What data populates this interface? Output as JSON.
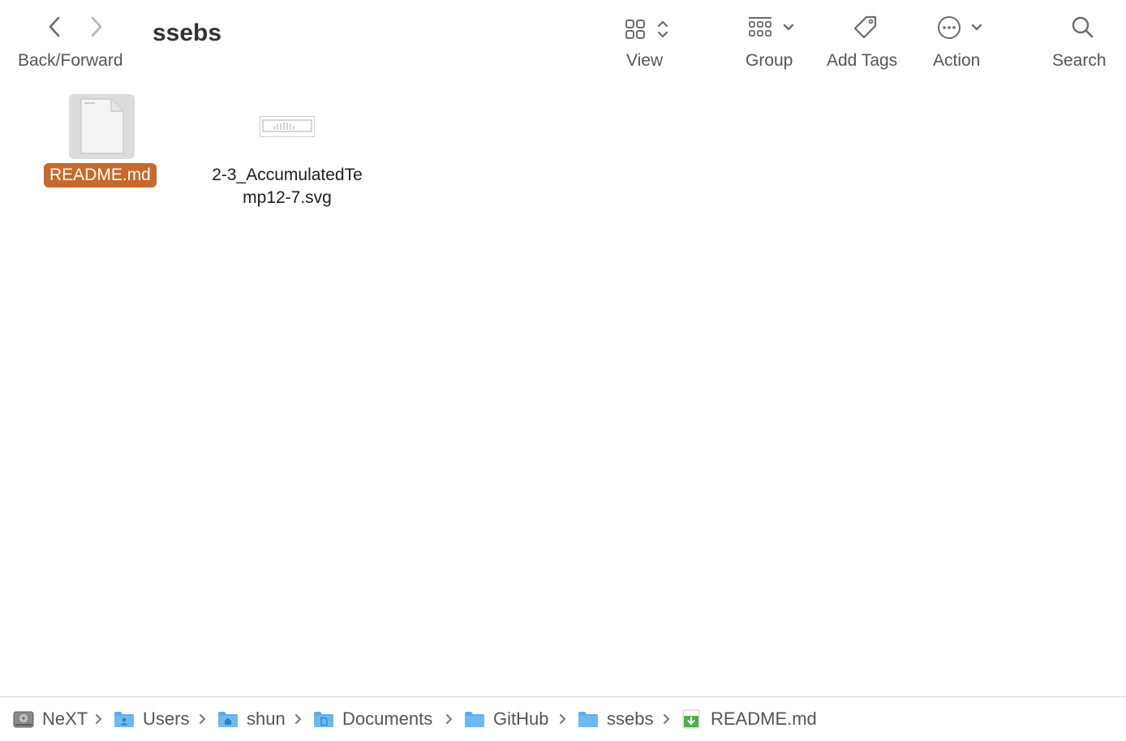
{
  "window": {
    "title": "ssebs"
  },
  "toolbar": {
    "back_forward": "Back/Forward",
    "view": "View",
    "group": "Group",
    "add_tags": "Add Tags",
    "action": "Action",
    "search": "Search"
  },
  "files": [
    {
      "name": "README.md",
      "icon": "document-icon",
      "selected": true
    },
    {
      "name_line1": "2-3_AccumulatedTe",
      "name_line2": "mp12-7.svg",
      "icon": "svg-thumbnail-icon",
      "selected": false
    }
  ],
  "pathbar": {
    "items": [
      {
        "label": "NeXT",
        "icon": "hard-drive-icon"
      },
      {
        "label": "Users",
        "icon": "users-folder-icon"
      },
      {
        "label": "shun",
        "icon": "home-folder-icon"
      },
      {
        "label": "Documents",
        "icon": "documents-folder-icon"
      },
      {
        "label": "GitHub",
        "icon": "folder-icon"
      },
      {
        "label": "ssebs",
        "icon": "folder-icon"
      },
      {
        "label": "README.md",
        "icon": "markdown-file-icon"
      }
    ]
  },
  "colors": {
    "selection": "#c8692a",
    "folder": "#5aaef0",
    "text_secondary": "#555555"
  }
}
